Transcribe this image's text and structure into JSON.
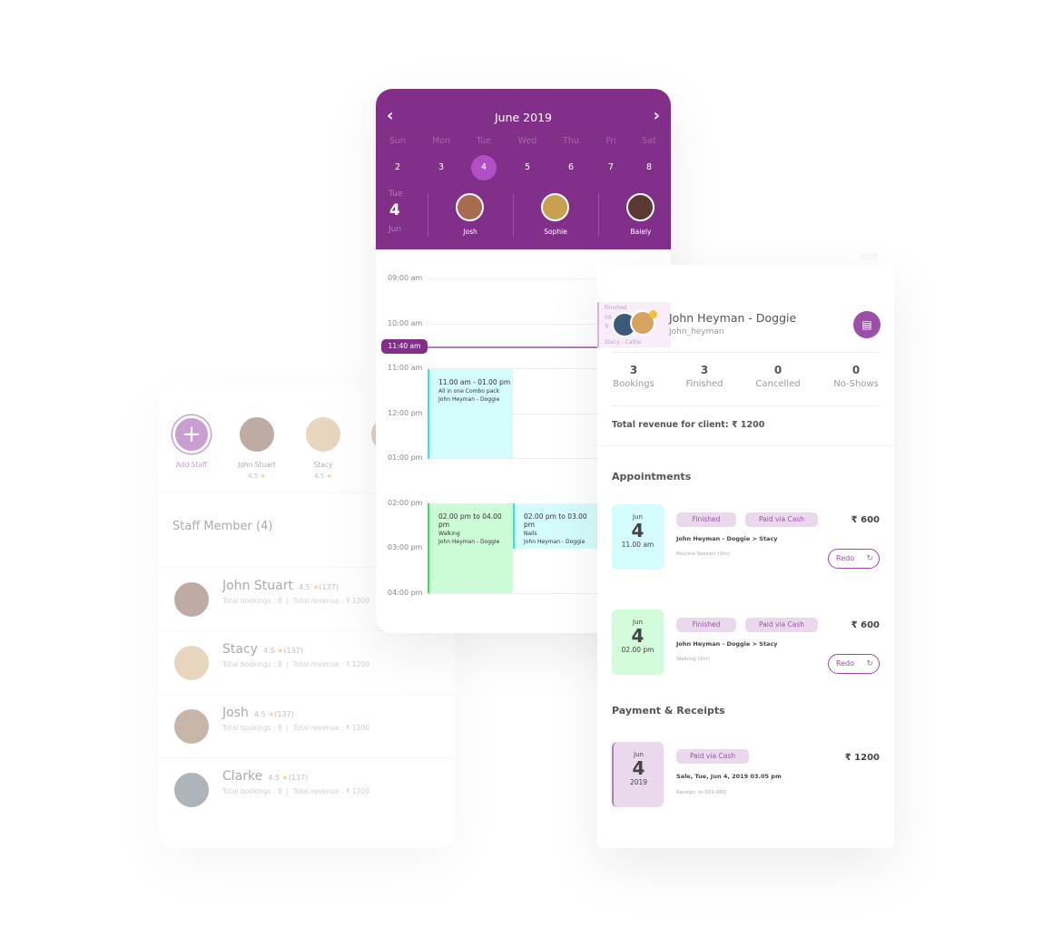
{
  "calendar": {
    "month_title": "June 2019",
    "weekdays": [
      "Sun",
      "Mon",
      "Tue",
      "Wed",
      "Thu",
      "Fri",
      "Sat"
    ],
    "days": [
      "2",
      "3",
      "4",
      "5",
      "6",
      "7",
      "8"
    ],
    "selected_day": "4",
    "selected_weekday": "Tue",
    "selected_month": "Jun",
    "staff": [
      "Josh",
      "Sophie",
      "Baiely"
    ],
    "accent": "#822f8a",
    "selected_color": "#b24fc5"
  },
  "schedule": {
    "times": [
      "09:00 am",
      "10:00 am",
      "11:00 am",
      "12:00 pm",
      "01:00 pm",
      "02:00 pm",
      "03:00 pm",
      "04:00 pm"
    ],
    "now": "11:40 am",
    "events": [
      {
        "time": "11.00 am - 01.00 pm",
        "service": "All in one Combo pack",
        "client": "John Heyman - Doggie",
        "color": "#d5fcfc",
        "border": "#2ee6e6"
      },
      {
        "time": "02.00 pm to 04.00 pm",
        "service": "Walking",
        "client": "John Heyman - Doggie",
        "color": "#ccfcd6",
        "border": "#2ee65a"
      },
      {
        "time": "02.00 pm to 03.00 pm",
        "service": "Nails",
        "client": "John Heyman - Doggie",
        "color": "#d5fcfc",
        "border": "#2ee6e6"
      }
    ],
    "hidden_event": {
      "status": "Finished",
      "time": "09",
      "line2": "Tr",
      "line3": "Stacy - Cattie"
    }
  },
  "client": {
    "edit": "Edit",
    "name": "John Heyman - Doggie",
    "username": "John_heyman",
    "stats": [
      {
        "n": "3",
        "l": "Bookings"
      },
      {
        "n": "3",
        "l": "Finished"
      },
      {
        "n": "0",
        "l": "Cancelled"
      },
      {
        "n": "0",
        "l": "No-Shows"
      }
    ],
    "revenue": "Total revenue for client: ₹ 1200",
    "appointments_title": "Appointments",
    "appointments": [
      {
        "month": "Jun",
        "day": "4",
        "time": "11.00 am",
        "status": "Finished",
        "payment": "Paid via Cash",
        "price": "₹ 600",
        "title": "John Heyman - Doggie > Stacy",
        "detail": "Routine Session (1hr)",
        "redo": "Redo"
      },
      {
        "month": "Jun",
        "day": "4",
        "time": "02.00 pm",
        "status": "Finished",
        "payment": "Paid via Cash",
        "price": "₹ 600",
        "title": "John Heyman - Doggie > Stacy",
        "detail": "Walking (1hr)",
        "redo": "Redo"
      }
    ],
    "payments_title": "Payment & Receipts",
    "receipt": {
      "month": "Jun",
      "day": "4",
      "year": "2019",
      "payment": "Paid via Cash",
      "price": "₹ 1200",
      "title": "Sale, Tue, Jun 4, 2019 03.05 pm",
      "receipt": "Receipt: In-001-0RQ"
    }
  },
  "staff": {
    "add_label": "Add Staff",
    "top": [
      {
        "name": "John Stuart",
        "rating": "4.5"
      },
      {
        "name": "Stacy",
        "rating": "4.5"
      }
    ],
    "title": "Staff Member (4)",
    "members": [
      {
        "name": "John Stuart",
        "rating": "4.5",
        "count": "(137)",
        "bookings": "Total bookings : 8",
        "revenue": "Total revenue : ₹ 1200"
      },
      {
        "name": "Stacy",
        "rating": "4.5",
        "count": "(137)",
        "bookings": "Total bookings : 8",
        "revenue": "Total revenue : ₹ 1200"
      },
      {
        "name": "Josh",
        "rating": "4.5",
        "count": "(137)",
        "bookings": "Total bookings : 8",
        "revenue": "Total revenue : ₹ 1200"
      },
      {
        "name": "Clarke",
        "rating": "4.5",
        "count": "(137)",
        "bookings": "Total bookings : 8",
        "revenue": "Total revenue : ₹ 1200"
      }
    ]
  }
}
